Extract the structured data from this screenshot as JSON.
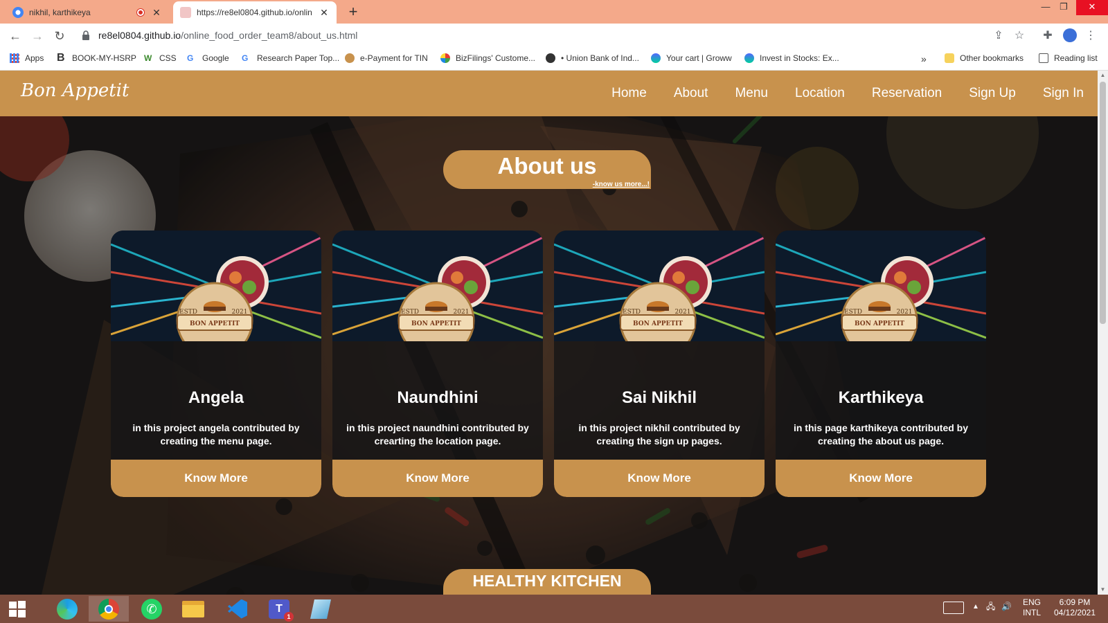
{
  "browser": {
    "tabs": [
      {
        "title": "nikhil, karthikeya",
        "active": false
      },
      {
        "title": "https://re8el0804.github.io/onlin",
        "active": true
      }
    ],
    "url_host": "re8el0804.github.io",
    "url_path": "/online_food_order_team8/about_us.html",
    "bookmarks": [
      {
        "label": "Apps",
        "icon": "apps-grid-icon"
      },
      {
        "label": "BOOK-MY-HSRP",
        "icon": "bold-b-icon"
      },
      {
        "label": "CSS",
        "icon": "w-icon"
      },
      {
        "label": "Google",
        "icon": "google-icon"
      },
      {
        "label": "Research Paper Top...",
        "icon": "google-icon"
      },
      {
        "label": "e-Payment for TIN",
        "icon": "emblem-icon"
      },
      {
        "label": "BizFilings' Custome...",
        "icon": "globe-icon"
      },
      {
        "label": "• Union Bank of Ind...",
        "icon": "union-bank-icon"
      },
      {
        "label": "Your cart | Groww",
        "icon": "groww-icon"
      },
      {
        "label": "Invest in Stocks: Ex...",
        "icon": "groww-icon"
      }
    ],
    "more_bookmarks": "»",
    "other_bookmarks": "Other bookmarks",
    "reading_list": "Reading list"
  },
  "site": {
    "brand": "Bon Appetit",
    "nav": [
      "Home",
      "About",
      "Menu",
      "Location",
      "Reservation",
      "Sign Up",
      "Sign In"
    ],
    "about_title": "About us",
    "about_subtitle": "-know us more...!",
    "cards": [
      {
        "name": "Angela",
        "description": "in this project angela contributed by creating the menu page.",
        "button": "Know More"
      },
      {
        "name": "Naundhini",
        "description": "in this project naundhini contributed by crearting the location page.",
        "button": "Know More"
      },
      {
        "name": "Sai Nikhil",
        "description": "in this project nikhil contributed by creating the sign up pages.",
        "button": "Know More"
      },
      {
        "name": "Karthikeya",
        "description": "in this page karthikeya contributed by creating the about us page.",
        "button": "Know More"
      }
    ],
    "logo_text": {
      "est": "ESTD",
      "year": "2021",
      "name": "BON APPETIT"
    },
    "healthy_kitchen": "HEALTHY KITCHEN"
  },
  "taskbar": {
    "apps": [
      "windows-start-icon",
      "edge-icon",
      "chrome-icon",
      "whatsapp-icon",
      "file-explorer-icon",
      "vscode-icon",
      "teams-icon",
      "notepad-icon"
    ],
    "teams_badge": "1",
    "lang": "ENG",
    "layout": "INTL",
    "time": "6:09 PM",
    "date": "04/12/2021"
  },
  "colors": {
    "accent": "#c8924d",
    "tabbar": "#f4a98a",
    "taskbar": "#7a4b3c"
  }
}
